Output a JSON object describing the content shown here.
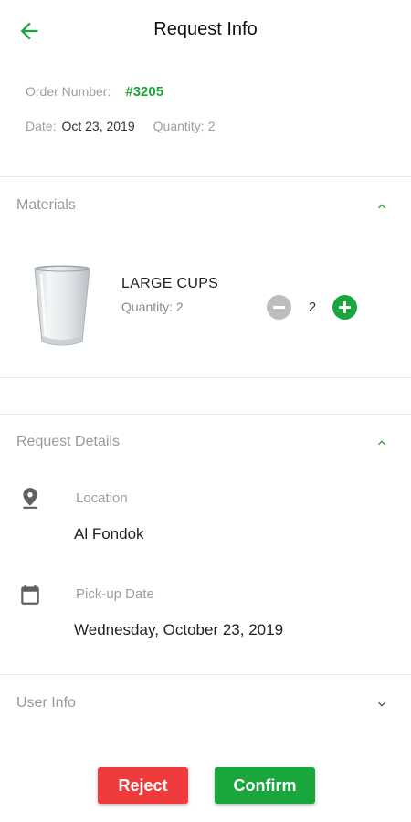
{
  "header": {
    "title": "Request Info"
  },
  "order": {
    "number_label": "Order Number:",
    "number": "#3205",
    "date_label": "Date:",
    "date": "Oct 23, 2019",
    "quantity_label": "Quantity:",
    "quantity": "2"
  },
  "materials": {
    "title": "Materials",
    "items": [
      {
        "name": "LARGE CUPS",
        "quantity_text": "Quantity: 2",
        "count": "2"
      }
    ]
  },
  "request_details": {
    "title": "Request Details",
    "location_label": "Location",
    "location": "Al Fondok",
    "pickup_label": "Pick-up Date",
    "pickup_date": "Wednesday, October 23, 2019"
  },
  "user_info": {
    "title": "User Info"
  },
  "actions": {
    "reject": "Reject",
    "confirm": "Confirm"
  },
  "colors": {
    "accent": "#18a63d",
    "reject": "#ef3b3b",
    "muted": "#9e9e9e"
  },
  "icons": {
    "back": "arrow-left-icon",
    "collapse": "chevron-up-icon",
    "expand": "chevron-down-icon",
    "location": "location-pin-icon",
    "calendar": "calendar-icon"
  }
}
